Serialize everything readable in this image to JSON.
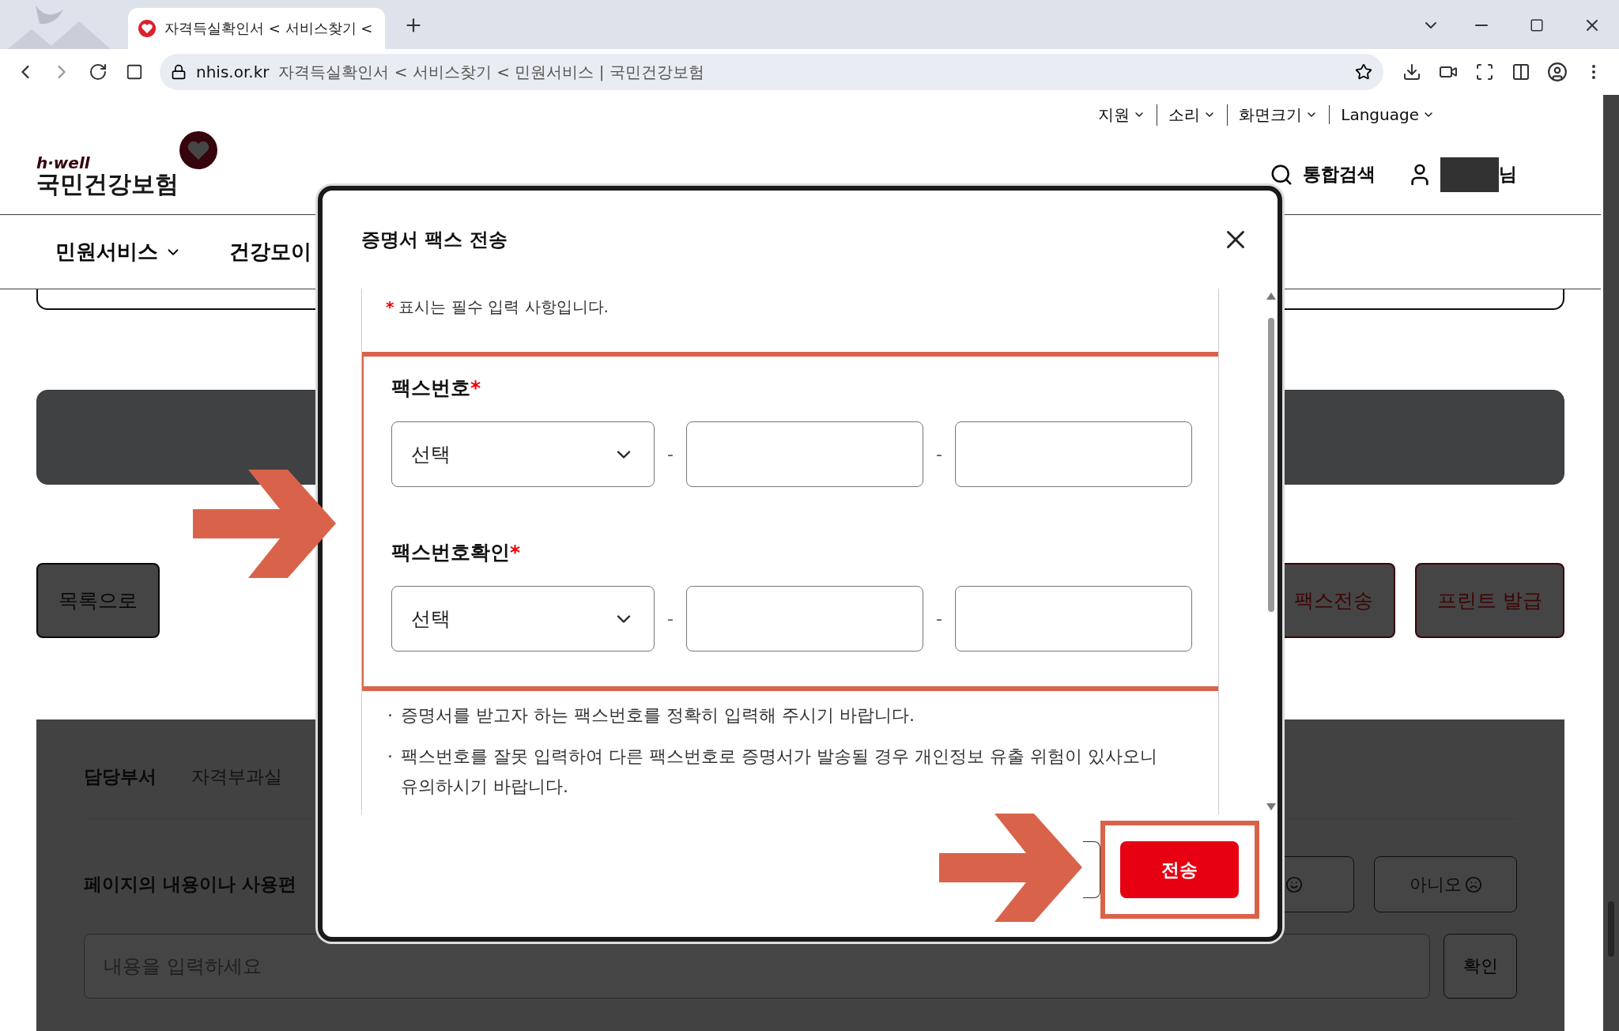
{
  "browser": {
    "tabs": [
      {
        "title": "자격득실확인서 < 서비스찾기 <",
        "selected": true
      }
    ],
    "url_domain": "nhis.or.kr",
    "url_title": "자격득실확인서 < 서비스찾기 < 민원서비스 | 국민건강보험"
  },
  "page": {
    "utility_links": [
      "지원",
      "소리",
      "화면크기",
      "Language"
    ],
    "logo": {
      "tagline": "h·well",
      "name": "국민건강보험"
    },
    "search_label": "통합검색",
    "user_suffix": "님",
    "nav": [
      "민원서비스",
      "건강모이"
    ],
    "buttons": [
      {
        "label": "목록으로",
        "kind": "outline"
      },
      {
        "label": "팩스전송",
        "kind": "accent"
      },
      {
        "label": "프린트 발급",
        "kind": "accent"
      }
    ],
    "department": {
      "label": "담당부서",
      "value": "자격부과실"
    },
    "feedback": {
      "question": "페이지의 내용이나 사용편",
      "no_label": "아니오",
      "placeholder": "내용을 입력하세요",
      "submit": "확인"
    }
  },
  "modal": {
    "title": "증명서 팩스 전송",
    "required_mark": "*",
    "required_note": "표시는 필수 입력 사항입니다.",
    "fields": [
      {
        "label": "팩스번호",
        "required": true,
        "select_value": "선택",
        "separators": [
          "-",
          "-"
        ]
      },
      {
        "label": "팩스번호확인",
        "required": true,
        "select_value": "선택",
        "separators": [
          "-",
          "-"
        ]
      }
    ],
    "notes": [
      {
        "bullet": "·",
        "text": "증명서를 받고자 하는 팩스번호를 정확히 입력해 주시기 바랍니다."
      },
      {
        "bullet": "·",
        "text": "팩스번호를 잘못 입력하여 다른 팩스번호로 증명서가 발송될 경우 개인정보 유출 위험이 있사오니 유의하시기 바랍니다."
      }
    ],
    "submit": "전송"
  }
}
